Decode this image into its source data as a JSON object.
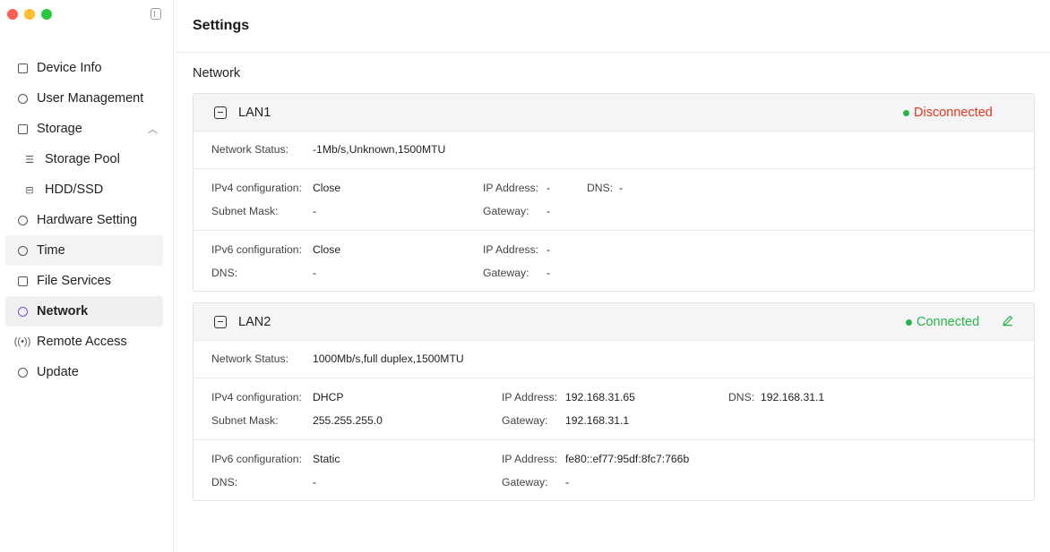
{
  "sidebar": {
    "items": [
      {
        "label": "Device Info",
        "icon": "device-icon"
      },
      {
        "label": "User Management",
        "icon": "user-icon"
      },
      {
        "label": "Storage",
        "icon": "storage-icon"
      },
      {
        "label": "Storage Pool",
        "icon": "pool-icon"
      },
      {
        "label": "HDD/SSD",
        "icon": "disk-icon"
      },
      {
        "label": "Hardware Setting",
        "icon": "hardware-icon"
      },
      {
        "label": "Time",
        "icon": "clock-icon"
      },
      {
        "label": "File Services",
        "icon": "file-icon"
      },
      {
        "label": "Network",
        "icon": "network-icon"
      },
      {
        "label": "Remote Access",
        "icon": "remote-icon"
      },
      {
        "label": "Update",
        "icon": "update-icon"
      }
    ]
  },
  "header": {
    "title": "Settings"
  },
  "section": {
    "title": "Network"
  },
  "colors": {
    "connected": "#2bb34a",
    "disconnected": "#e03a1d",
    "accent": "#7b4dd6"
  },
  "lan1": {
    "name": "LAN1",
    "status": "Disconnected",
    "network_status_label": "Network Status:",
    "network_status_value": "-1Mb/s,Unknown,1500MTU",
    "ipv4_label": "IPv4 configuration:",
    "ipv4_value": "Close",
    "ipv4_ip_label": "IP Address:",
    "ipv4_ip_value": "-",
    "ipv4_dns_label": "DNS:",
    "ipv4_dns_value": "-",
    "subnet_label": "Subnet Mask:",
    "subnet_value": "-",
    "ipv4_gateway_label": "Gateway:",
    "ipv4_gateway_value": "-",
    "ipv6_label": "IPv6 configuration:",
    "ipv6_value": "Close",
    "ipv6_ip_label": "IP Address:",
    "ipv6_ip_value": "-",
    "ipv6_dns_label": "DNS:",
    "ipv6_dns_value": "-",
    "ipv6_gateway_label": "Gateway:",
    "ipv6_gateway_value": "-"
  },
  "lan2": {
    "name": "LAN2",
    "status": "Connected",
    "network_status_label": "Network Status:",
    "network_status_value": "1000Mb/s,full duplex,1500MTU",
    "ipv4_label": "IPv4 configuration:",
    "ipv4_value": "DHCP",
    "ipv4_ip_label": "IP Address:",
    "ipv4_ip_value": "192.168.31.65",
    "ipv4_dns_label": "DNS:",
    "ipv4_dns_value": "192.168.31.1",
    "subnet_label": "Subnet Mask:",
    "subnet_value": "255.255.255.0",
    "ipv4_gateway_label": "Gateway:",
    "ipv4_gateway_value": "192.168.31.1",
    "ipv6_label": "IPv6 configuration:",
    "ipv6_value": "Static",
    "ipv6_ip_label": "IP Address:",
    "ipv6_ip_value": "fe80::ef77:95df:8fc7:766b",
    "ipv6_dns_label": "DNS:",
    "ipv6_dns_value": "-",
    "ipv6_gateway_label": "Gateway:",
    "ipv6_gateway_value": "-"
  }
}
